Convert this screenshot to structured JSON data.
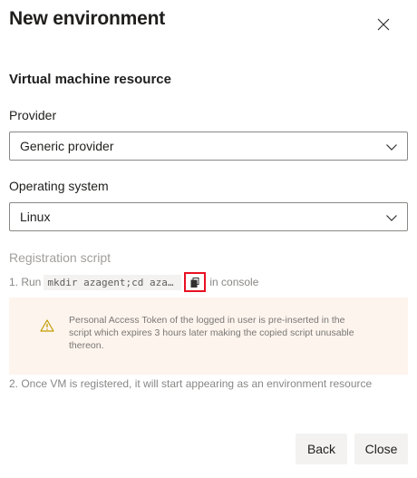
{
  "header": {
    "title": "New environment",
    "close_icon": "close-icon"
  },
  "section": {
    "title": "Virtual machine resource"
  },
  "provider": {
    "label": "Provider",
    "value": "Generic provider",
    "icon": "chevron-down-icon"
  },
  "os": {
    "label": "Operating system",
    "value": "Linux",
    "icon": "chevron-down-icon"
  },
  "registration": {
    "label": "Registration script",
    "step1_prefix": "1. Run",
    "step1_code": "mkdir azagent;cd azagent;",
    "step1_code_display": "mkdir azagent;cd azagent…",
    "copy_icon": "copy-icon",
    "step1_suffix": "in console",
    "warning_icon": "warning-icon",
    "warning_text": "Personal Access Token of the logged in user is pre-inserted in the script which expires 3 hours later making the copied script unusable thereon.",
    "step2": "2. Once VM is registered, it will start appearing as an environment resource"
  },
  "footer": {
    "back_label": "Back",
    "close_label": "Close"
  },
  "colors": {
    "highlight_box": "#e81123",
    "warning_bg": "#fdf4ed",
    "warning_icon": "#c19c00",
    "button_bg": "#f3f2f1"
  }
}
